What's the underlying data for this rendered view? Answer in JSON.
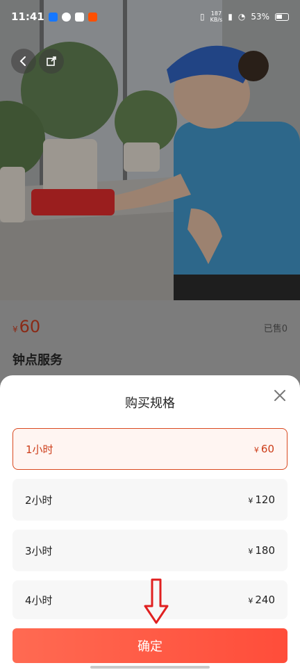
{
  "status_bar": {
    "time": "11:41",
    "net_speed_top": "187",
    "net_speed_bottom": "KB/s",
    "battery": "53%"
  },
  "nav": {
    "back_icon": "chevron-left-icon",
    "share_icon": "share-icon"
  },
  "product": {
    "currency": "¥",
    "price": "60",
    "sold_label": "已售0",
    "title": "钟点服务"
  },
  "sheet": {
    "title": "购买规格",
    "options": [
      {
        "label": "1小时",
        "currency": "¥",
        "price": "60",
        "selected": true
      },
      {
        "label": "2小时",
        "currency": "¥",
        "price": "120",
        "selected": false
      },
      {
        "label": "3小时",
        "currency": "¥",
        "price": "180",
        "selected": false
      },
      {
        "label": "4小时",
        "currency": "¥",
        "price": "240",
        "selected": false
      }
    ],
    "confirm_label": "确定"
  },
  "colors": {
    "accent": "#ff5540",
    "selected_border": "#d9481f",
    "annotation_red": "#e02020"
  }
}
